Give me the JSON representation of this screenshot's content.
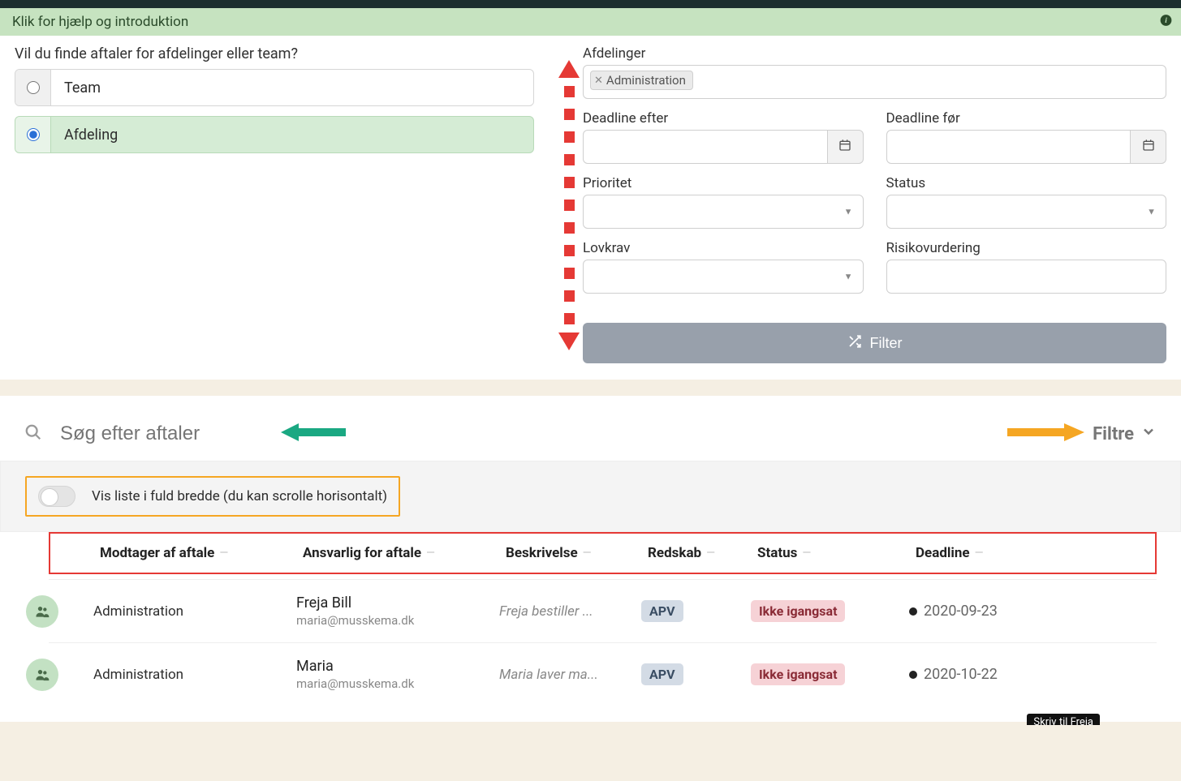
{
  "help_banner": "Klik for hjælp og introduktion",
  "filter": {
    "question": "Vil du finde aftaler for afdelinger eller team?",
    "options": {
      "team": "Team",
      "afdeling": "Afdeling"
    },
    "afdelinger_label": "Afdelinger",
    "afdelinger_tag": "Administration",
    "deadline_after_label": "Deadline efter",
    "deadline_before_label": "Deadline før",
    "prioritet_label": "Prioritet",
    "status_label": "Status",
    "lovkrav_label": "Lovkrav",
    "risikovurdering_label": "Risikovurdering",
    "button": "Filter"
  },
  "search": {
    "placeholder": "Søg efter aftaler",
    "filtre_label": "Filtre"
  },
  "fullwidth": {
    "label": "Vis liste i fuld bredde (du kan scrolle horisontalt)"
  },
  "columns": {
    "modtager": "Modtager af aftale",
    "ansvarlig": "Ansvarlig for aftale",
    "beskrivelse": "Beskrivelse",
    "redskab": "Redskab",
    "status": "Status",
    "deadline": "Deadline"
  },
  "rows": [
    {
      "modtager": "Administration",
      "ansvarlig_name": "Freja Bill",
      "ansvarlig_email": "maria@musskema.dk",
      "beskrivelse": "Freja bestiller ...",
      "redskab": "APV",
      "status": "Ikke igangsat",
      "deadline": "2020-09-23"
    },
    {
      "modtager": "Administration",
      "ansvarlig_name": "Maria",
      "ansvarlig_email": "maria@musskema.dk",
      "beskrivelse": "Maria laver ma...",
      "redskab": "APV",
      "status": "Ikke igangsat",
      "deadline": "2020-10-22"
    }
  ],
  "floating_btn": "Skriv til Freja"
}
